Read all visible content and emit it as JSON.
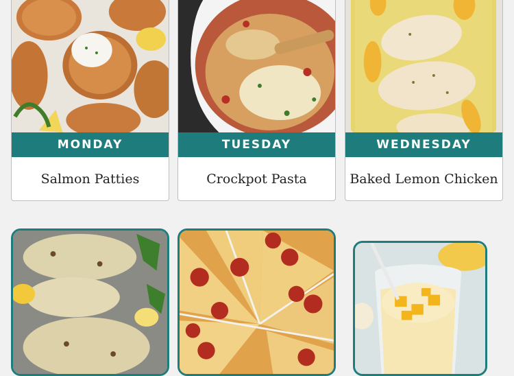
{
  "menu": {
    "days": [
      {
        "day": "MONDAY",
        "meal": "Salmon Patties",
        "image_icon": "salmon-patties-photo"
      },
      {
        "day": "TUESDAY",
        "meal": "Crockpot Pasta",
        "image_icon": "crockpot-pasta-photo"
      },
      {
        "day": "WEDNESDAY",
        "meal": "Baked Lemon Chicken",
        "image_icon": "baked-lemon-chicken-photo"
      }
    ],
    "next_row": [
      {
        "image_icon": "roasted-cauliflower-photo"
      },
      {
        "image_icon": "pepperoni-pizza-photo"
      },
      {
        "image_icon": "mango-smoothie-photo"
      }
    ]
  },
  "colors": {
    "accent": "#1e7d7c",
    "background": "#f1f1f1",
    "card": "#ffffff"
  }
}
